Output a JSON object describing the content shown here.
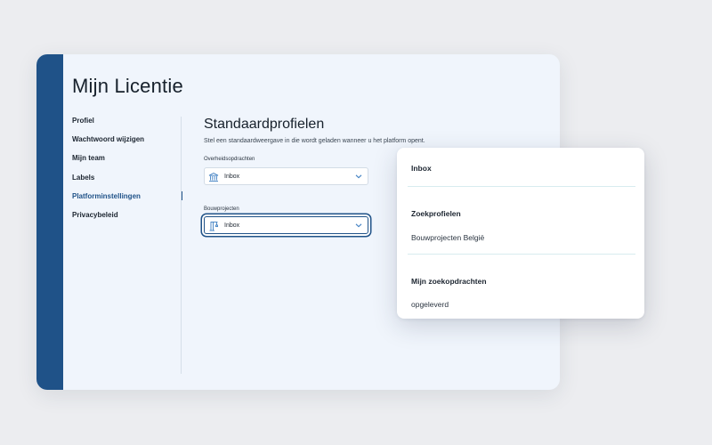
{
  "page": {
    "title": "Mijn Licentie"
  },
  "sidebar": {
    "items": [
      {
        "label": "Profiel",
        "active": false
      },
      {
        "label": "Wachtwoord wijzigen",
        "active": false
      },
      {
        "label": "Mijn team",
        "active": false
      },
      {
        "label": "Labels",
        "active": false
      },
      {
        "label": "Platforminstellingen",
        "active": true
      },
      {
        "label": "Privacybeleid",
        "active": false
      }
    ]
  },
  "main": {
    "section_title": "Standaardprofielen",
    "section_description": "Stel een standaardweergave in die wordt geladen wanneer u het platform opent.",
    "fields": [
      {
        "label": "Overheidsopdrachten",
        "value": "Inbox",
        "icon": "building-icon",
        "focused": false
      },
      {
        "label": "Bouwprojecten",
        "value": "Inbox",
        "icon": "crane-icon",
        "focused": true
      }
    ]
  },
  "dropdown": {
    "inbox_label": "Inbox",
    "group_1_header": "Zoekprofielen",
    "group_1_items": [
      "Bouwprojecten België"
    ],
    "group_2_header": "Mijn zoekopdrachten",
    "group_2_items": [
      "opgeleverd"
    ]
  },
  "colors": {
    "brand": "#1f5288",
    "card_background": "#f0f5fc",
    "page_background": "#ecedf0",
    "chevron": "#3f7fc2"
  }
}
